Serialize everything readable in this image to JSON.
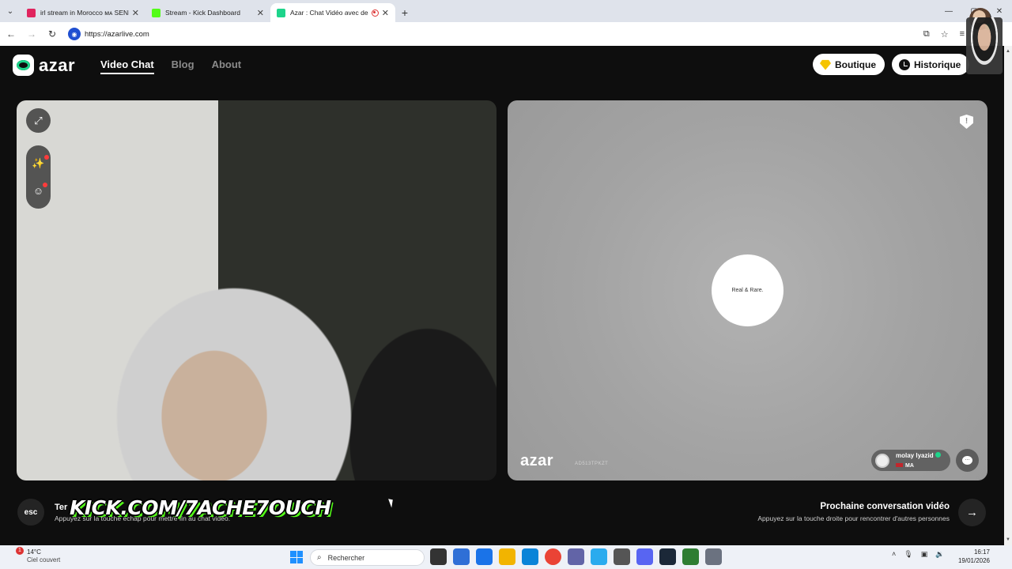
{
  "browser": {
    "tabs": [
      {
        "title": "irl stream in Morocco ᴍᴀ SENE",
        "favicon_color": "#e0245e",
        "active": false
      },
      {
        "title": "Stream - Kick Dashboard",
        "favicon_color": "#53fc18",
        "active": false
      },
      {
        "title": "Azar : Chat Vidéo avec de n",
        "favicon_color": "#1ed48b",
        "active": true
      }
    ],
    "close_glyph": "✕",
    "new_tab_glyph": "+",
    "menu_glyph": "⌄",
    "window_controls": [
      "—",
      "▢",
      "✕"
    ],
    "url": "https://azarlive.com",
    "nav_icons": {
      "back": "←",
      "forward": "→",
      "reload": "↻"
    },
    "addr_icons": {
      "install": "⧉",
      "bookmark": "☆",
      "reading_list": "≡"
    }
  },
  "header": {
    "logo_text": "azar",
    "menu": [
      {
        "label": "Video Chat",
        "active": true
      },
      {
        "label": "Blog",
        "active": false
      },
      {
        "label": "About",
        "active": false
      }
    ],
    "shop_label": "Boutique",
    "history_label": "Historique"
  },
  "local_video": {
    "tools": {
      "fullscreen": "⤢",
      "effects": "✨",
      "sticker": "☺"
    }
  },
  "remote_video": {
    "report_glyph": "!",
    "loader_text": "Real & Rare.",
    "logo_text": "azar",
    "session_code": "AD513TPKZT",
    "partner": {
      "name": "molay lyazid",
      "country": "MA"
    },
    "chat_glyph": "…"
  },
  "controls": {
    "esc_label": "esc",
    "end_title": "Ter",
    "end_hint": "Appuyez sur la touche echap pour mettre fin au chat vidéo.",
    "overlay_text": "KICK.COM/7ACHE7OUCH",
    "next_title": "Prochaine conversation vidéo",
    "next_hint": "Appuyez sur la touche droite pour rencontrer d'autres personnes",
    "next_glyph": "→"
  },
  "taskbar": {
    "weather_badge": "1",
    "temperature": "14°C",
    "weather_desc": "Ciel couvert",
    "search_placeholder": "Rechercher",
    "search_glyph": "⌕",
    "tray_icons": {
      "chevron": "˄",
      "mic": "🎙",
      "network": "▣",
      "volume": "🔉"
    },
    "time": "16:17",
    "date": "19/01/2026",
    "app_colors": [
      "#333333",
      "#2f6fd6",
      "#1a73e8",
      "#f2b400",
      "#0a84d8",
      "#ea4335",
      "#6264a7",
      "#2aabee",
      "#555555",
      "#5865f2",
      "#1b2838",
      "#2e7d32",
      "#6b7280"
    ]
  },
  "colors": {
    "brand_green": "#1ed48b",
    "kick_green": "#53fc18",
    "accent_red": "#ff3b3b"
  }
}
